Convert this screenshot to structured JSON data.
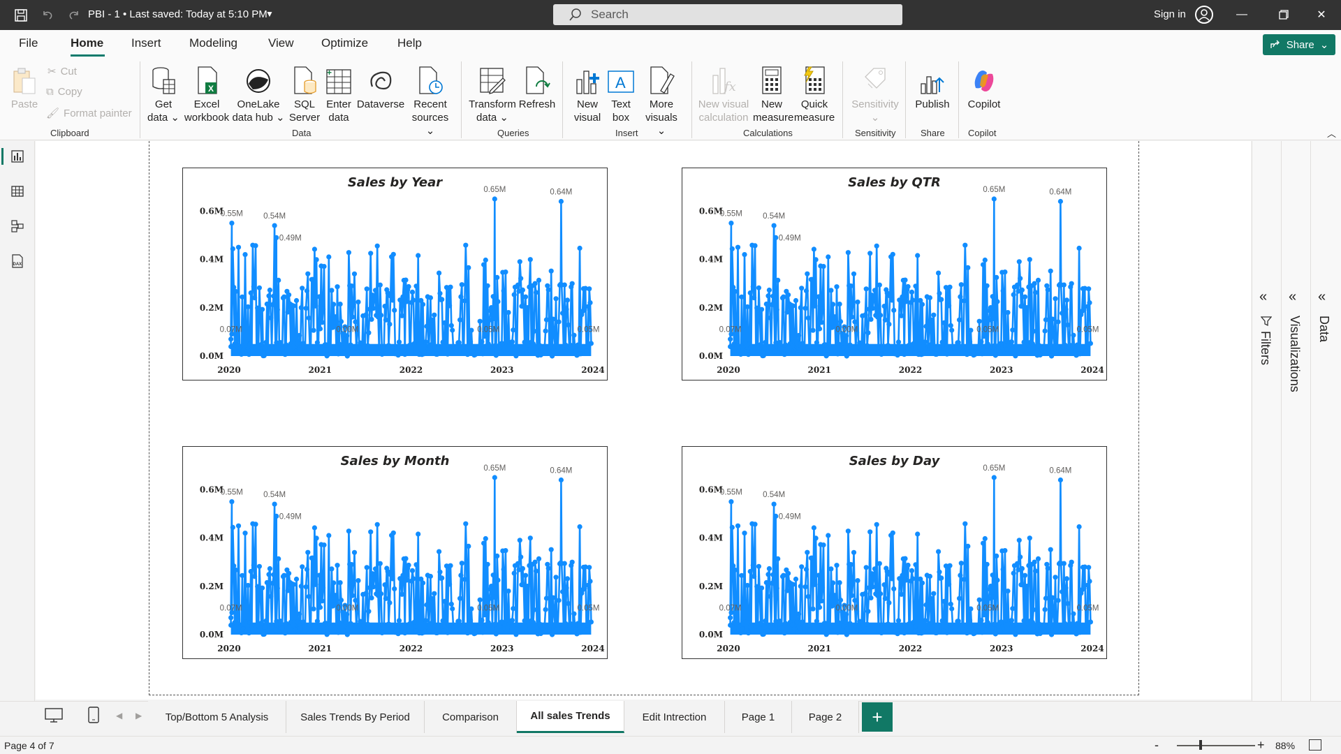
{
  "titlebar": {
    "title": "PBI - 1  •  Last saved: Today at 5:10 PM",
    "search_placeholder": "Search",
    "signin": "Sign in"
  },
  "menu": {
    "tabs": [
      "File",
      "Home",
      "Insert",
      "Modeling",
      "View",
      "Optimize",
      "Help"
    ],
    "active": "Home",
    "share": "Share"
  },
  "ribbon": {
    "clipboard": {
      "paste": "Paste",
      "cut": "Cut",
      "copy": "Copy",
      "format_painter": "Format painter",
      "label": "Clipboard"
    },
    "data": {
      "get_data": [
        "Get",
        "data ⌄"
      ],
      "excel": [
        "Excel",
        "workbook"
      ],
      "onelake": [
        "OneLake",
        "data hub ⌄"
      ],
      "sql": [
        "SQL",
        "Server"
      ],
      "enter": [
        "Enter",
        "data"
      ],
      "dataverse": [
        "Dataverse"
      ],
      "recent": [
        "Recent",
        "sources ⌄"
      ],
      "label": "Data"
    },
    "queries": {
      "transform": [
        "Transform",
        "data ⌄"
      ],
      "refresh": [
        "Refresh"
      ],
      "label": "Queries"
    },
    "insert": {
      "new_visual": [
        "New",
        "visual"
      ],
      "text_box": [
        "Text",
        "box"
      ],
      "more_visuals": [
        "More",
        "visuals ⌄"
      ],
      "label": "Insert"
    },
    "calculations": {
      "new_visual_calc": [
        "New visual",
        "calculation"
      ],
      "new_measure": [
        "New",
        "measure"
      ],
      "quick_measure": [
        "Quick",
        "measure"
      ],
      "label": "Calculations"
    },
    "sensitivity": {
      "btn": [
        "Sensitivity",
        "⌄"
      ],
      "label": "Sensitivity"
    },
    "share": {
      "publish": [
        "Publish"
      ],
      "label": "Share"
    },
    "copilot": {
      "btn": [
        "Copilot"
      ],
      "label": "Copilot"
    }
  },
  "panes": {
    "filters": "Filters",
    "visualizations": "Visualizations",
    "data": "Data"
  },
  "page_tabs": [
    "Top/Bottom 5 Analysis",
    "Sales Trends By Period",
    "Comparison",
    "All sales Trends",
    "Edit Intrection",
    "Page 1",
    "Page 2"
  ],
  "active_tab": "All sales Trends",
  "status": {
    "page": "Page 4 of 7",
    "zoom": "88%",
    "zoom_level": 0.88
  },
  "colors": {
    "series": "#118DFF",
    "accent": "#117865"
  },
  "chart_data": [
    {
      "type": "line",
      "title": "Sales by Year",
      "x_ticks": [
        "2020",
        "2021",
        "2022",
        "2023",
        "2024"
      ],
      "y_ticks": [
        "0.0M",
        "0.2M",
        "0.4M",
        "0.6M"
      ],
      "ylim": [
        0,
        0.65
      ],
      "unit": "M",
      "annotations": [
        "0.55M",
        "0.54M",
        "0.49M",
        "0.65M",
        "0.64M",
        "0.07M",
        "0.00M",
        "0.05M",
        "0.05M"
      ],
      "peaks": [
        {
          "x": 2020.03,
          "y": 0.55
        },
        {
          "x": 2020.5,
          "y": 0.54
        },
        {
          "x": 2020.52,
          "y": 0.49
        },
        {
          "x": 2022.92,
          "y": 0.65
        },
        {
          "x": 2023.65,
          "y": 0.64
        },
        {
          "x": 2020.02,
          "y": 0.07
        },
        {
          "x": 2021.3,
          "y": 0.0
        },
        {
          "x": 2022.85,
          "y": 0.05
        },
        {
          "x": 2023.95,
          "y": 0.05
        }
      ]
    },
    {
      "type": "line",
      "title": "Sales by QTR",
      "x_ticks": [
        "2020",
        "2021",
        "2022",
        "2023",
        "2024"
      ],
      "y_ticks": [
        "0.0M",
        "0.2M",
        "0.4M",
        "0.6M"
      ],
      "ylim": [
        0,
        0.65
      ],
      "unit": "M",
      "annotations": [
        "0.55M",
        "0.54M",
        "0.49M",
        "0.65M",
        "0.64M",
        "0.07M",
        "0.00M",
        "0.05M",
        "0.05M"
      ],
      "peaks": [
        {
          "x": 2020.03,
          "y": 0.55
        },
        {
          "x": 2020.5,
          "y": 0.54
        },
        {
          "x": 2020.52,
          "y": 0.49
        },
        {
          "x": 2022.92,
          "y": 0.65
        },
        {
          "x": 2023.65,
          "y": 0.64
        },
        {
          "x": 2020.02,
          "y": 0.07
        },
        {
          "x": 2021.3,
          "y": 0.0
        },
        {
          "x": 2022.85,
          "y": 0.05
        },
        {
          "x": 2023.95,
          "y": 0.05
        }
      ]
    },
    {
      "type": "line",
      "title": "Sales by Month",
      "x_ticks": [
        "2020",
        "2021",
        "2022",
        "2023",
        "2024"
      ],
      "y_ticks": [
        "0.0M",
        "0.2M",
        "0.4M",
        "0.6M"
      ],
      "ylim": [
        0,
        0.65
      ],
      "unit": "M",
      "annotations": [
        "0.55M",
        "0.54M",
        "0.49M",
        "0.65M",
        "0.64M",
        "0.07M",
        "0.00M",
        "0.05M",
        "0.05M"
      ],
      "peaks": [
        {
          "x": 2020.03,
          "y": 0.55
        },
        {
          "x": 2020.5,
          "y": 0.54
        },
        {
          "x": 2020.52,
          "y": 0.49
        },
        {
          "x": 2022.92,
          "y": 0.65
        },
        {
          "x": 2023.65,
          "y": 0.64
        },
        {
          "x": 2020.02,
          "y": 0.07
        },
        {
          "x": 2021.3,
          "y": 0.0
        },
        {
          "x": 2022.85,
          "y": 0.05
        },
        {
          "x": 2023.95,
          "y": 0.05
        }
      ]
    },
    {
      "type": "line",
      "title": "Sales by Day",
      "x_ticks": [
        "2020",
        "2021",
        "2022",
        "2023",
        "2024"
      ],
      "y_ticks": [
        "0.0M",
        "0.2M",
        "0.4M",
        "0.6M"
      ],
      "ylim": [
        0,
        0.65
      ],
      "unit": "M",
      "annotations": [
        "0.55M",
        "0.54M",
        "0.49M",
        "0.65M",
        "0.64M",
        "0.07M",
        "0.00M",
        "0.05M",
        "0.05M"
      ],
      "peaks": [
        {
          "x": 2020.03,
          "y": 0.55
        },
        {
          "x": 2020.5,
          "y": 0.54
        },
        {
          "x": 2020.52,
          "y": 0.49
        },
        {
          "x": 2022.92,
          "y": 0.65
        },
        {
          "x": 2023.65,
          "y": 0.64
        },
        {
          "x": 2020.02,
          "y": 0.07
        },
        {
          "x": 2021.3,
          "y": 0.0
        },
        {
          "x": 2022.85,
          "y": 0.05
        },
        {
          "x": 2023.95,
          "y": 0.05
        }
      ]
    }
  ]
}
